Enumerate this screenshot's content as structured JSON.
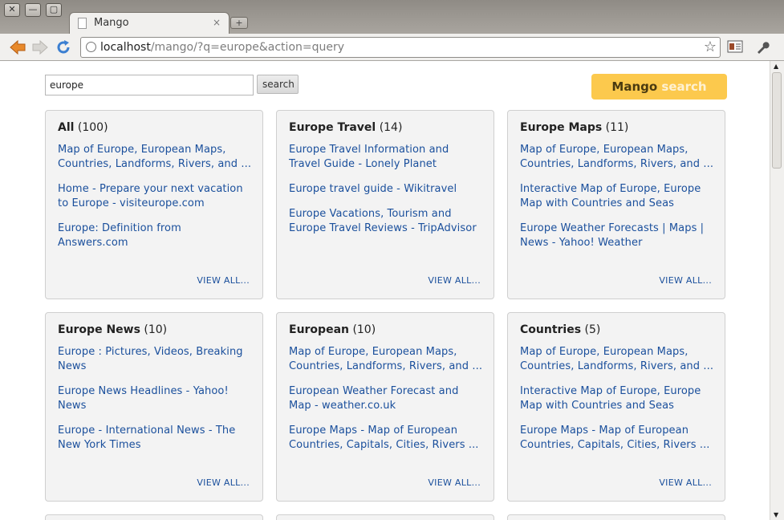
{
  "browser": {
    "tab_title": "Mango",
    "tab_close": "×",
    "new_tab": "+",
    "url_host": "localhost",
    "url_path": "/mango/?q=europe&action=query",
    "window_buttons": [
      "✕",
      "—",
      "▢"
    ]
  },
  "search": {
    "query": "europe",
    "button_label": "search"
  },
  "logo": {
    "part1": "Mango",
    "part2": "search"
  },
  "cards": [
    {
      "title": "All",
      "count": "(100)",
      "links": [
        "Map of Europe, European Maps, Countries, Landforms, Rivers, and ...",
        "Home - Prepare your next vacation to Europe - visiteurope.com",
        "Europe: Definition from Answers.com"
      ],
      "view_all": "VIEW ALL..."
    },
    {
      "title": "Europe Travel",
      "count": "(14)",
      "links": [
        "Europe Travel Information and Travel Guide - Lonely Planet",
        "Europe travel guide - Wikitravel",
        "Europe Vacations, Tourism and Europe Travel Reviews - TripAdvisor"
      ],
      "view_all": "VIEW ALL..."
    },
    {
      "title": "Europe Maps",
      "count": "(11)",
      "links": [
        "Map of Europe, European Maps, Countries, Landforms, Rivers, and ...",
        "Interactive Map of Europe, Europe Map with Countries and Seas",
        "Europe Weather Forecasts | Maps | News - Yahoo! Weather"
      ],
      "view_all": "VIEW ALL..."
    },
    {
      "title": "Europe News",
      "count": "(10)",
      "links": [
        "Europe : Pictures, Videos, Breaking News",
        "Europe News Headlines - Yahoo! News",
        "Europe - International News - The New York Times"
      ],
      "view_all": "VIEW ALL..."
    },
    {
      "title": "European",
      "count": "(10)",
      "links": [
        "Map of Europe, European Maps, Countries, Landforms, Rivers, and ...",
        "European Weather Forecast and Map - weather.co.uk",
        "Europe Maps - Map of European Countries, Capitals, Cities, Rivers ..."
      ],
      "view_all": "VIEW ALL..."
    },
    {
      "title": "Countries",
      "count": "(5)",
      "links": [
        "Map of Europe, European Maps, Countries, Landforms, Rivers, and ...",
        "Interactive Map of Europe, Europe Map with Countries and Seas",
        "Europe Maps - Map of European Countries, Capitals, Cities, Rivers ..."
      ],
      "view_all": "VIEW ALL..."
    }
  ],
  "colors": {
    "logo_bg": "#fcc94d",
    "link": "#1a4f9c",
    "card_bg": "#f3f3f3"
  }
}
